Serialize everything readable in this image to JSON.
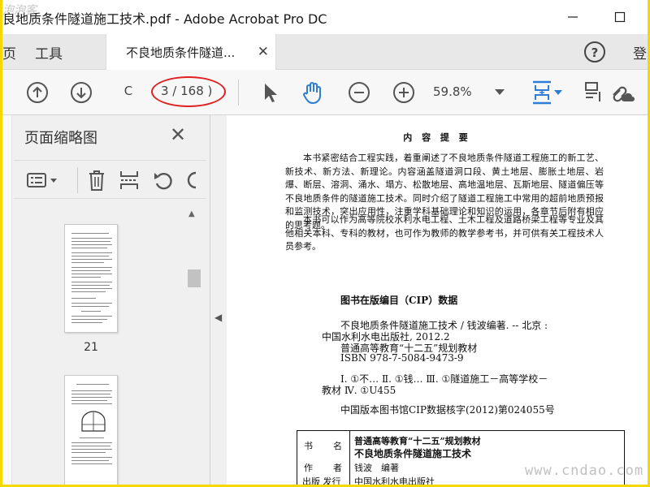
{
  "window": {
    "title": "良地质条件隧道施工技术.pdf - Adobe Acrobat Pro DC",
    "watermark_top": "泡泡客"
  },
  "tabs": {
    "partial_left": "页",
    "tools": "工具",
    "active_doc": "不良地质条件隧道...",
    "partial_right": "登"
  },
  "toolbar": {
    "page_input": "C",
    "page_count": "3 / 168 )",
    "zoom": "59.8%"
  },
  "sidebar": {
    "title": "页面缩略图",
    "thumbnails": [
      {
        "label": "21"
      },
      {
        "label": ""
      }
    ]
  },
  "document": {
    "heading": "内 容 提 要",
    "para1": "本书紧密结合工程实践，着重阐述了不良地质条件隧道工程施工的新工艺、新技术、新方法、新理论。内容涵盖隧道洞口段、黄土地层、膨胀土地层、岩爆、断层、溶洞、涌水、塌方、松散地层、高地温地层、瓦斯地层、隧道偏压等不良地质条件的隧道施工技术。同时介绍了隧道工程施工中常用的超前地质预报和监测技术，突出应用性，注重学科基础理论和知识的运用，各章节后附有相应的思考题。",
    "para2": "本书可以作为高等院校水利水电工程、土木工程及道路桥梁工程等专业及其他相关本科、专科的教材，也可作为教师的教学参考书，并可供有关工程技术人员参考。",
    "cip_title": "图书在版编目（CIP）数据",
    "cip_lines": [
      "不良地质条件隧道施工技术 / 钱波编著. -- 北京 :",
      "中国水利水电出版社, 2012.2",
      "普通高等教育“十二五”规划教材",
      "ISBN 978-7-5084-9473-9",
      "Ⅰ. ①不… Ⅱ. ①钱… Ⅲ. ①隧道施工－高等学校－",
      "教材 Ⅳ. ①U455",
      "中国版本图书馆CIP数据核字(2012)第024055号"
    ],
    "table": {
      "row1_label_a": "书",
      "row1_label_b": "名",
      "row1_series": "普通高等教育“十二五”规划教材",
      "row1_title": "不良地质条件隧道施工技术",
      "row2_label_a": "作",
      "row2_label_b": "者",
      "row2_value": "钱波　编著",
      "row3_label": "出版 发行",
      "row3_value": "中国水利水电出版社"
    }
  },
  "watermark_bottom": "www.cndao.com",
  "colors": {
    "accent_blue": "#2d7cd6",
    "annotation_red": "#e02020",
    "frame_yellow": "#f5d800"
  }
}
